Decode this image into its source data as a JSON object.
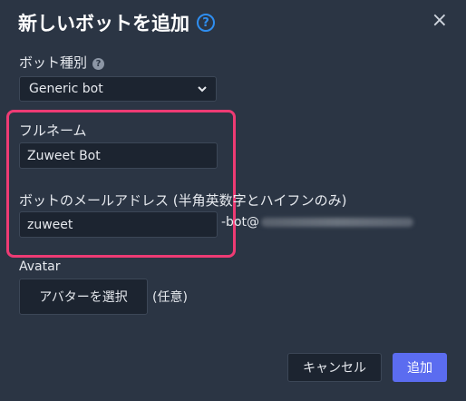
{
  "dialog": {
    "title": "新しいボットを追加",
    "help_glyph": "?",
    "close_glyph": "×"
  },
  "bot_type": {
    "label": "ボット種別",
    "help_glyph": "?",
    "selected": "Generic bot"
  },
  "full_name": {
    "label": "フルネーム",
    "value": "Zuweet Bot"
  },
  "bot_email": {
    "label": "ボットのメールアドレス (半角英数字とハイフンのみ)",
    "value": "zuweet",
    "suffix": "-bot@"
  },
  "avatar": {
    "label": "Avatar",
    "button_label": "アバターを選択",
    "optional_text": "(任意)"
  },
  "footer": {
    "cancel_label": "キャンセル",
    "add_label": "追加"
  },
  "colors": {
    "accent": "#5b6cf0",
    "highlight": "#ee3b74",
    "help": "#2f8ef0"
  }
}
